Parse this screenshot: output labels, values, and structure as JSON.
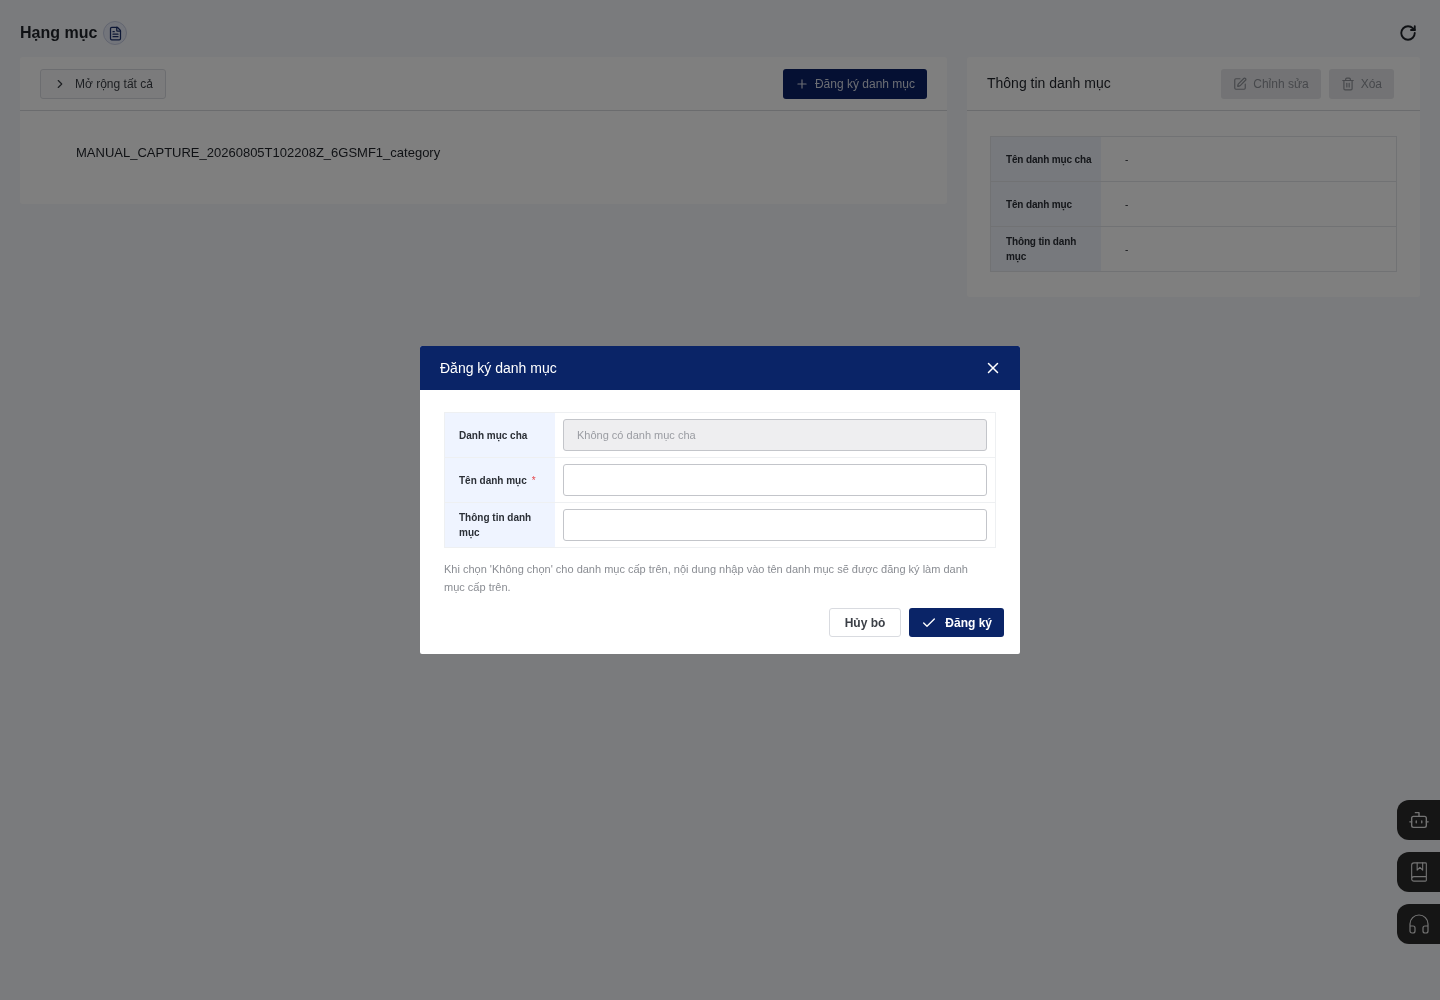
{
  "page": {
    "title": "Hạng mục"
  },
  "tree_panel": {
    "expand_all_button": "Mở rộng tất cả",
    "register_button": "Đăng ký danh mục",
    "items": [
      {
        "label": "MANUAL_CAPTURE_20260805T102208Z_6GSMF1_category"
      }
    ]
  },
  "detail_panel": {
    "title": "Thông tin danh mục",
    "buttons": [
      {
        "kind": "edit",
        "label": "Chỉnh sửa",
        "disabled": true
      },
      {
        "kind": "delete",
        "label": "Xóa",
        "disabled": true
      }
    ],
    "rows": [
      {
        "label": "Tên danh mục cha",
        "value": "-"
      },
      {
        "label": "Tên danh mục",
        "value": "-"
      },
      {
        "label": "Thông tin danh mục",
        "value": "-"
      }
    ]
  },
  "dialog": {
    "title": "Đăng ký danh mục",
    "fields": [
      {
        "label": "Danh mục cha",
        "placeholder": "Không có danh mục cha",
        "disabled": true
      },
      {
        "label": "Tên danh mục",
        "required_mark": "*",
        "disabled": false
      },
      {
        "label": "Thông tin danh mục",
        "disabled": false
      }
    ],
    "note": "Khi chọn 'Không chọn' cho danh mục cấp trên, nội dung nhập vào tên danh mục sẽ được đăng ký làm danh mục cấp trên.",
    "buttons": [
      {
        "kind": "secondary",
        "label": "Hủy bỏ"
      },
      {
        "kind": "primary",
        "label": "Đăng ký"
      }
    ]
  },
  "floating_buttons": [
    {
      "kind": "chatbot"
    },
    {
      "kind": "guide"
    },
    {
      "kind": "support"
    }
  ]
}
